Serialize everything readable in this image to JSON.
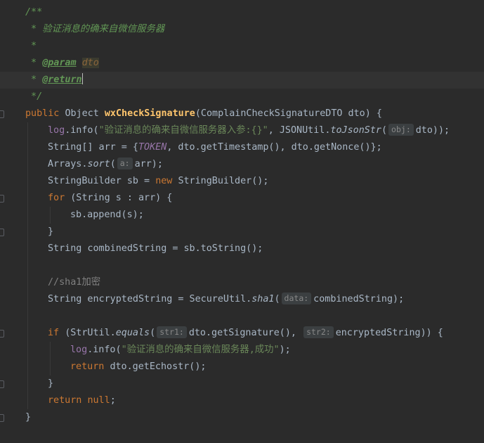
{
  "editor": {
    "lines": [
      {
        "parts": [
          [
            "doc",
            "/**"
          ]
        ]
      },
      {
        "parts": [
          [
            "doc",
            " * 验证消息的确来自微信服务器"
          ]
        ]
      },
      {
        "parts": [
          [
            "doc",
            " *"
          ]
        ]
      },
      {
        "parts": [
          [
            "doc",
            " * "
          ],
          [
            "tag",
            "@param"
          ],
          [
            "doc",
            " "
          ],
          [
            "docval",
            "dto"
          ]
        ]
      },
      {
        "parts": [
          [
            "doc",
            " * "
          ],
          [
            "tag",
            "@return"
          ],
          [
            "cursor",
            ""
          ]
        ],
        "current": true
      },
      {
        "parts": [
          [
            "doc",
            " */"
          ]
        ]
      },
      {
        "parts": [
          [
            "kw",
            "public "
          ],
          [
            "plain",
            "Object "
          ],
          [
            "fn",
            "wxCheckSignature"
          ],
          [
            "plain",
            "(ComplainCheckSignatureDTO dto) {"
          ]
        ]
      },
      {
        "indent": 1,
        "parts": [
          [
            "field",
            "log"
          ],
          [
            "plain",
            "."
          ],
          [
            "plain",
            "info("
          ],
          [
            "str",
            "\"验证消息的确来自微信服务器入参:{}\""
          ],
          [
            "plain",
            ", JSONUtil."
          ],
          [
            "static",
            "toJsonStr"
          ],
          [
            "plain",
            "("
          ],
          [
            "hint",
            "obj:"
          ],
          [
            "plain",
            "dto));"
          ]
        ]
      },
      {
        "indent": 1,
        "parts": [
          [
            "plain",
            "String[] arr = {"
          ],
          [
            "const",
            "TOKEN"
          ],
          [
            "plain",
            ", dto.getTimestamp(), dto.getNonce()};"
          ]
        ]
      },
      {
        "indent": 1,
        "parts": [
          [
            "plain",
            "Arrays."
          ],
          [
            "static",
            "sort"
          ],
          [
            "plain",
            "("
          ],
          [
            "hint",
            "a:"
          ],
          [
            "plain",
            "arr);"
          ]
        ]
      },
      {
        "indent": 1,
        "parts": [
          [
            "plain",
            "StringBuilder sb = "
          ],
          [
            "kw",
            "new "
          ],
          [
            "plain",
            "StringBuilder();"
          ]
        ]
      },
      {
        "indent": 1,
        "parts": [
          [
            "kw",
            "for "
          ],
          [
            "plain",
            "(String s : arr) {"
          ]
        ]
      },
      {
        "indent": 2,
        "parts": [
          [
            "plain",
            "sb.append(s);"
          ]
        ]
      },
      {
        "indent": 1,
        "parts": [
          [
            "plain",
            "}"
          ]
        ]
      },
      {
        "indent": 1,
        "parts": [
          [
            "plain",
            "String combinedString = sb.toString();"
          ]
        ]
      },
      {
        "parts": []
      },
      {
        "indent": 1,
        "parts": [
          [
            "cmt",
            "//sha1加密"
          ]
        ]
      },
      {
        "indent": 1,
        "parts": [
          [
            "plain",
            "String encryptedString = SecureUtil."
          ],
          [
            "static",
            "sha1"
          ],
          [
            "plain",
            "("
          ],
          [
            "hint",
            "data:"
          ],
          [
            "plain",
            "combinedString);"
          ]
        ]
      },
      {
        "parts": []
      },
      {
        "indent": 1,
        "parts": [
          [
            "kw",
            "if "
          ],
          [
            "plain",
            "(StrUtil."
          ],
          [
            "static",
            "equals"
          ],
          [
            "plain",
            "("
          ],
          [
            "hint",
            "str1:"
          ],
          [
            "plain",
            "dto.getSignature(), "
          ],
          [
            "hint",
            "str2:"
          ],
          [
            "plain",
            "encryptedString)) {"
          ]
        ]
      },
      {
        "indent": 2,
        "parts": [
          [
            "field",
            "log"
          ],
          [
            "plain",
            ".info("
          ],
          [
            "str",
            "\"验证消息的确来自微信服务器,成功\""
          ],
          [
            "plain",
            ");"
          ]
        ]
      },
      {
        "indent": 2,
        "parts": [
          [
            "kw",
            "return "
          ],
          [
            "plain",
            "dto.getEchostr();"
          ]
        ]
      },
      {
        "indent": 1,
        "parts": [
          [
            "plain",
            "}"
          ]
        ]
      },
      {
        "indent": 1,
        "parts": [
          [
            "kw",
            "return "
          ],
          [
            "kw",
            "null"
          ],
          [
            "plain",
            ";"
          ]
        ]
      },
      {
        "parts": [
          [
            "plain",
            "}"
          ]
        ]
      }
    ]
  },
  "gutter": {
    "fold_markers": [
      6,
      11,
      13,
      19,
      22,
      24
    ],
    "intention_icon": "lightbulb-icon"
  },
  "colors": {
    "background": "#2b2b2b",
    "current_line": "#323232",
    "keyword": "#cc7832",
    "doc_comment": "#629755",
    "method_decl": "#ffc66d",
    "string": "#6a8759",
    "field": "#9876aa",
    "comment": "#808080",
    "lightbulb": "#e8b71f"
  }
}
